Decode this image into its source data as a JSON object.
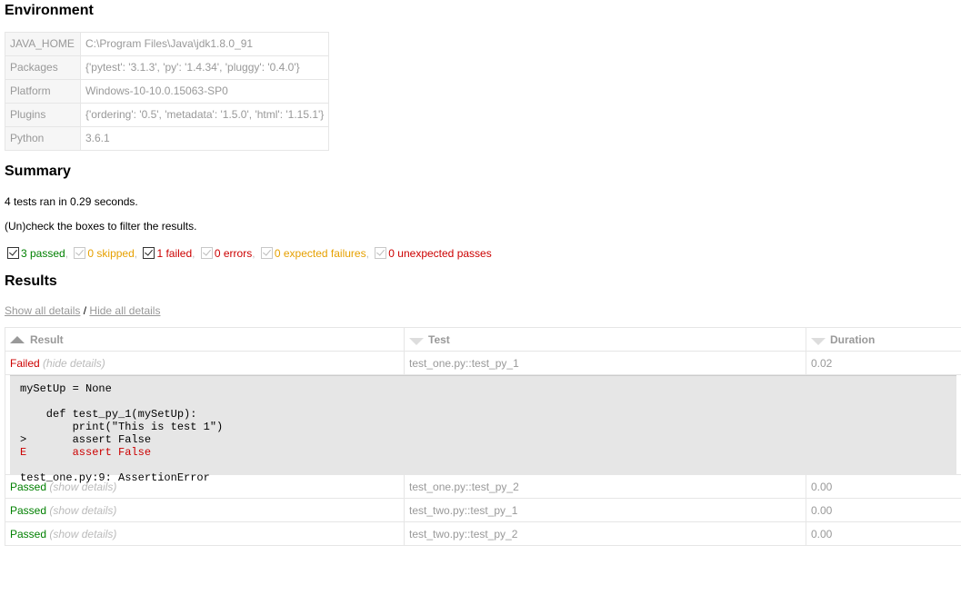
{
  "environment": {
    "heading": "Environment",
    "rows": [
      {
        "key": "JAVA_HOME",
        "value": "C:\\Program Files\\Java\\jdk1.8.0_91"
      },
      {
        "key": "Packages",
        "value": "{'pytest': '3.1.3', 'py': '1.4.34', 'pluggy': '0.4.0'}"
      },
      {
        "key": "Platform",
        "value": "Windows-10-10.0.15063-SP0"
      },
      {
        "key": "Plugins",
        "value": "{'ordering': '0.5', 'metadata': '1.5.0', 'html': '1.15.1'}"
      },
      {
        "key": "Python",
        "value": "3.6.1"
      }
    ]
  },
  "summary": {
    "heading": "Summary",
    "ran_text": "4 tests ran in 0.29 seconds.",
    "filter_text": "(Un)check the boxes to filter the results.",
    "filters": [
      {
        "label": "3 passed",
        "color": "#008000",
        "checked": true
      },
      {
        "label": "0 skipped",
        "color": "#e6a000",
        "checked": true
      },
      {
        "label": "1 failed",
        "color": "#cc0000",
        "checked": true
      },
      {
        "label": "0 errors",
        "color": "#cc0000",
        "checked": true
      },
      {
        "label": "0 expected failures",
        "color": "#e6a000",
        "checked": true
      },
      {
        "label": "0 unexpected passes",
        "color": "#cc0000",
        "checked": true
      }
    ],
    "separator": ","
  },
  "results": {
    "heading": "Results",
    "show_all": "Show all details",
    "slash": "/",
    "hide_all": "Hide all details",
    "columns": {
      "result": "Result",
      "test": "Test",
      "duration": "Duration"
    },
    "rows": [
      {
        "result": "Failed",
        "toggle": "(hide details)",
        "test": "test_one.py::test_py_1",
        "duration": "0.02",
        "log": {
          "line1": "mySetUp = None",
          "line2": "",
          "line3": "    def test_py_1(mySetUp):",
          "line4": "        print(\"This is test 1\")",
          "line5": ">       assert False",
          "line6": "E       assert False",
          "line7": "",
          "line8": "test_one.py:9: AssertionError"
        }
      },
      {
        "result": "Passed",
        "toggle": "(show details)",
        "test": "test_one.py::test_py_2",
        "duration": "0.00"
      },
      {
        "result": "Passed",
        "toggle": "(show details)",
        "test": "test_two.py::test_py_1",
        "duration": "0.00"
      },
      {
        "result": "Passed",
        "toggle": "(show details)",
        "test": "test_two.py::test_py_2",
        "duration": "0.00"
      }
    ]
  },
  "colors": {
    "passed": "#008000",
    "failed": "#cc0000",
    "skipped": "#e6a000",
    "muted": "#999999",
    "log_bg": "#e6e6e6"
  }
}
